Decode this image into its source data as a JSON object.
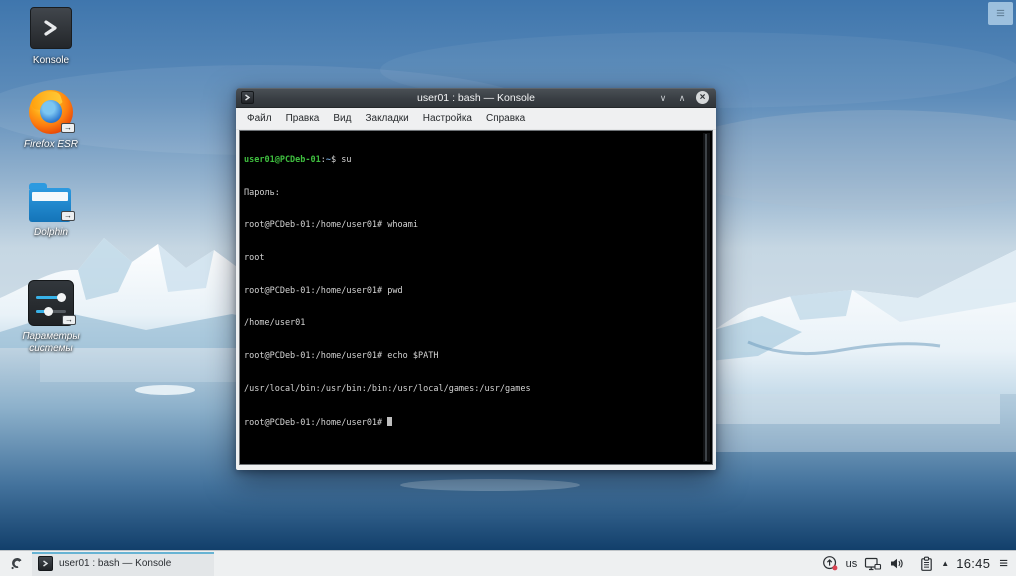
{
  "desktop": {
    "icons": [
      {
        "name": "konsole",
        "label": "Konsole"
      },
      {
        "name": "firefox-esr",
        "label": "Firefox ESR"
      },
      {
        "name": "dolphin",
        "label": "Dolphin"
      },
      {
        "name": "system-settings",
        "label": "Параметры системы"
      }
    ]
  },
  "window": {
    "title": "user01 : bash — Konsole",
    "menu": [
      "Файл",
      "Правка",
      "Вид",
      "Закладки",
      "Настройка",
      "Справка"
    ],
    "terminal": {
      "prompt_user": "user01@PCDeb-01",
      "prompt_colon": ":",
      "prompt_path": "~",
      "prompt_rest": "$ su",
      "lines": [
        "Пароль:",
        "root@PCDeb-01:/home/user01# whoami",
        "root",
        "root@PCDeb-01:/home/user01# pwd",
        "/home/user01",
        "root@PCDeb-01:/home/user01# echo $PATH",
        "/usr/local/bin:/usr/bin:/bin:/usr/local/games:/usr/games",
        "root@PCDeb-01:/home/user01# "
      ]
    }
  },
  "taskbar": {
    "task_label": "user01 : bash — Konsole",
    "keyboard_layout": "us",
    "clock": "16:45"
  },
  "glyphs": {
    "minimize": "∨",
    "maximize": "∧",
    "close": "×",
    "tray_expander": "▲",
    "hamburger": "≡",
    "emblem_arrow": "→"
  },
  "theme": {
    "titlebar_bg": "#383d42",
    "menubar_bg": "#eff0f1",
    "terminal_bg": "#000000",
    "terminal_fg": "#d4d4d4",
    "prompt_green": "#3fbf3f",
    "prompt_blue": "#6d9fd0",
    "taskbar_bg": "#eef0f1",
    "active_task_line": "#67b3d3",
    "water_deep": "#0d3a66",
    "sky_top": "#3f76ad"
  }
}
